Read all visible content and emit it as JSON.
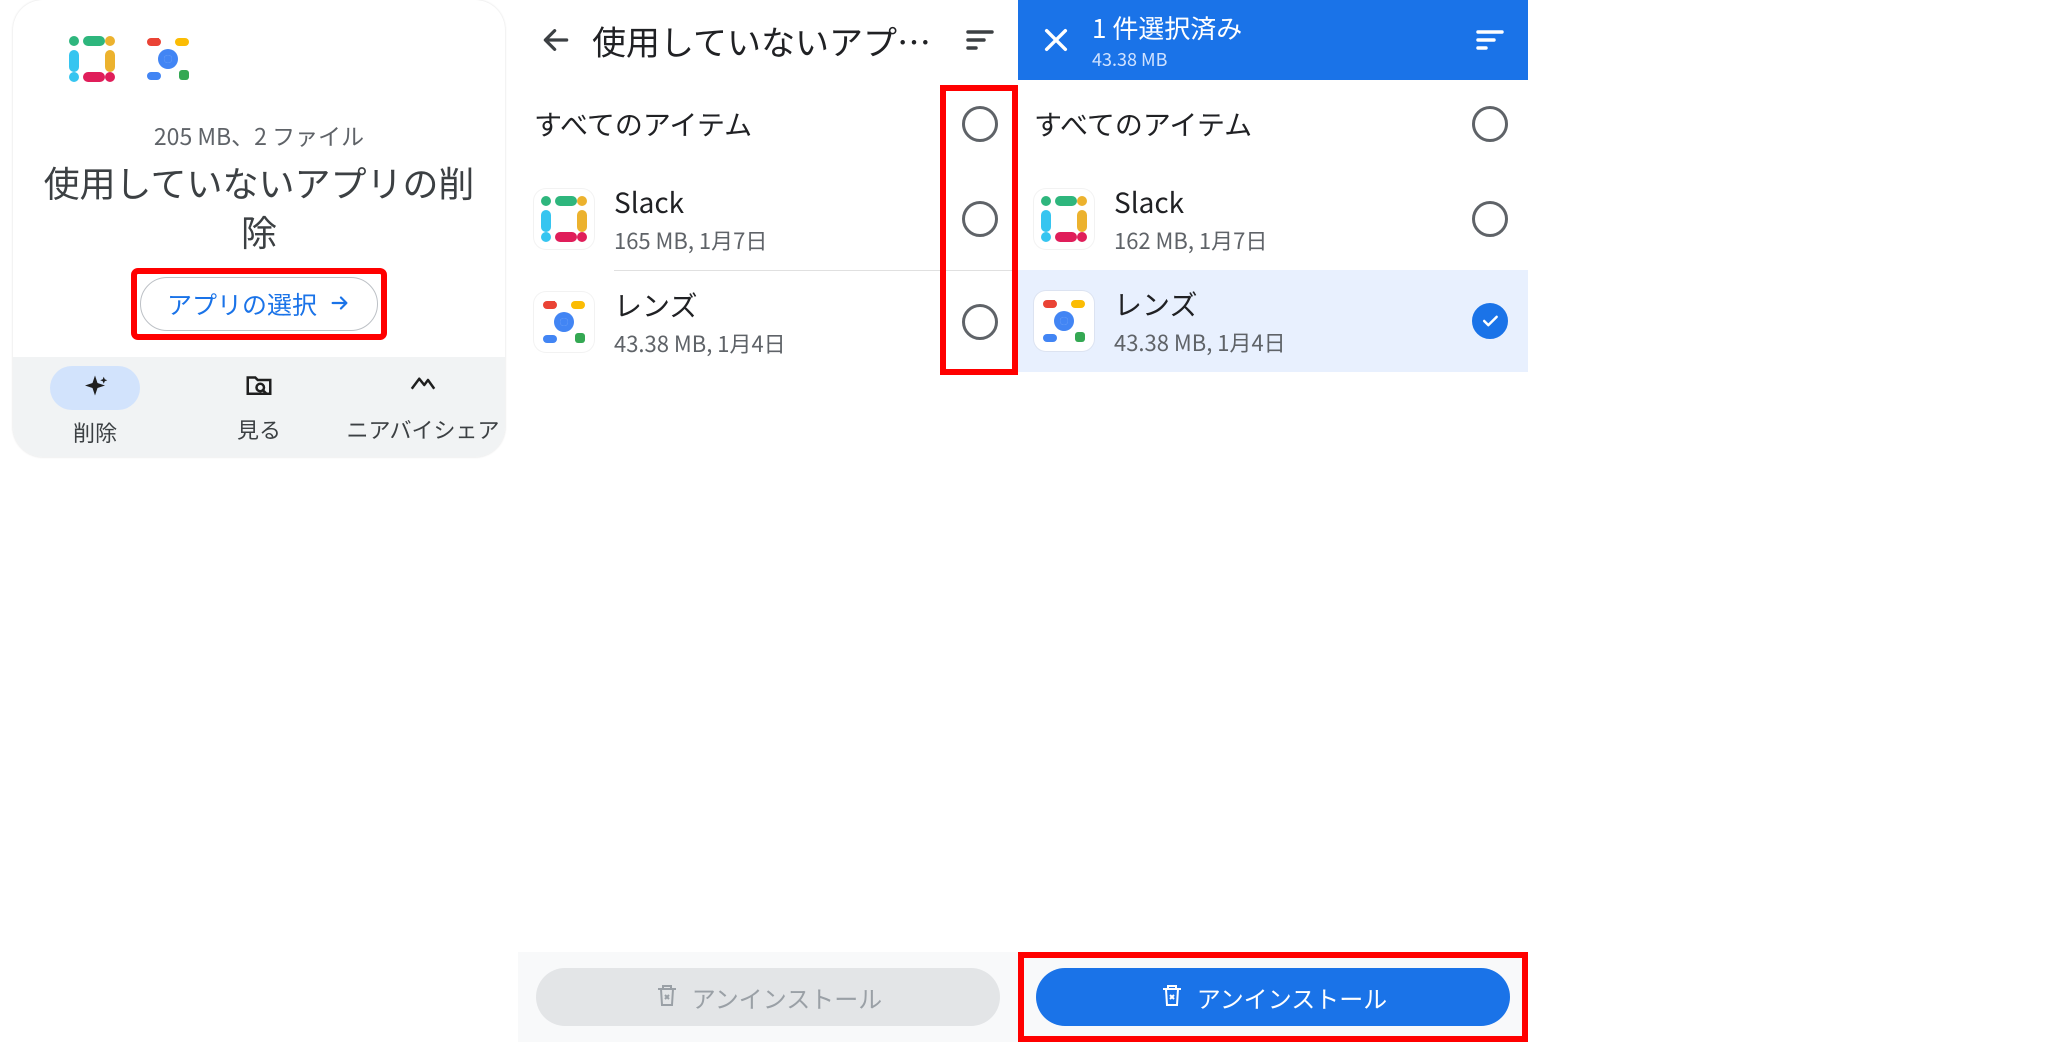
{
  "panel1": {
    "meta": "205 MB、2 ファイル",
    "title": "使用していないアプリの削除",
    "select_label": "アプリの選択",
    "nav": {
      "delete": "削除",
      "browse": "見る",
      "share": "ニアバイシェア"
    }
  },
  "panel2": {
    "title": "使用していないアプ…",
    "all_items": "すべてのアイテム",
    "rows": [
      {
        "name": "Slack",
        "sub": "165 MB, 1月7日"
      },
      {
        "name": "レンズ",
        "sub": "43.38 MB, 1月4日"
      }
    ],
    "uninstall": "アンインストール"
  },
  "panel3": {
    "header_title": "1 件選択済み",
    "header_sub": "43.38 MB",
    "all_items": "すべてのアイテム",
    "rows": [
      {
        "name": "Slack",
        "sub": "162 MB, 1月7日"
      },
      {
        "name": "レンズ",
        "sub": "43.38 MB, 1月4日"
      }
    ],
    "uninstall": "アンインストール"
  }
}
